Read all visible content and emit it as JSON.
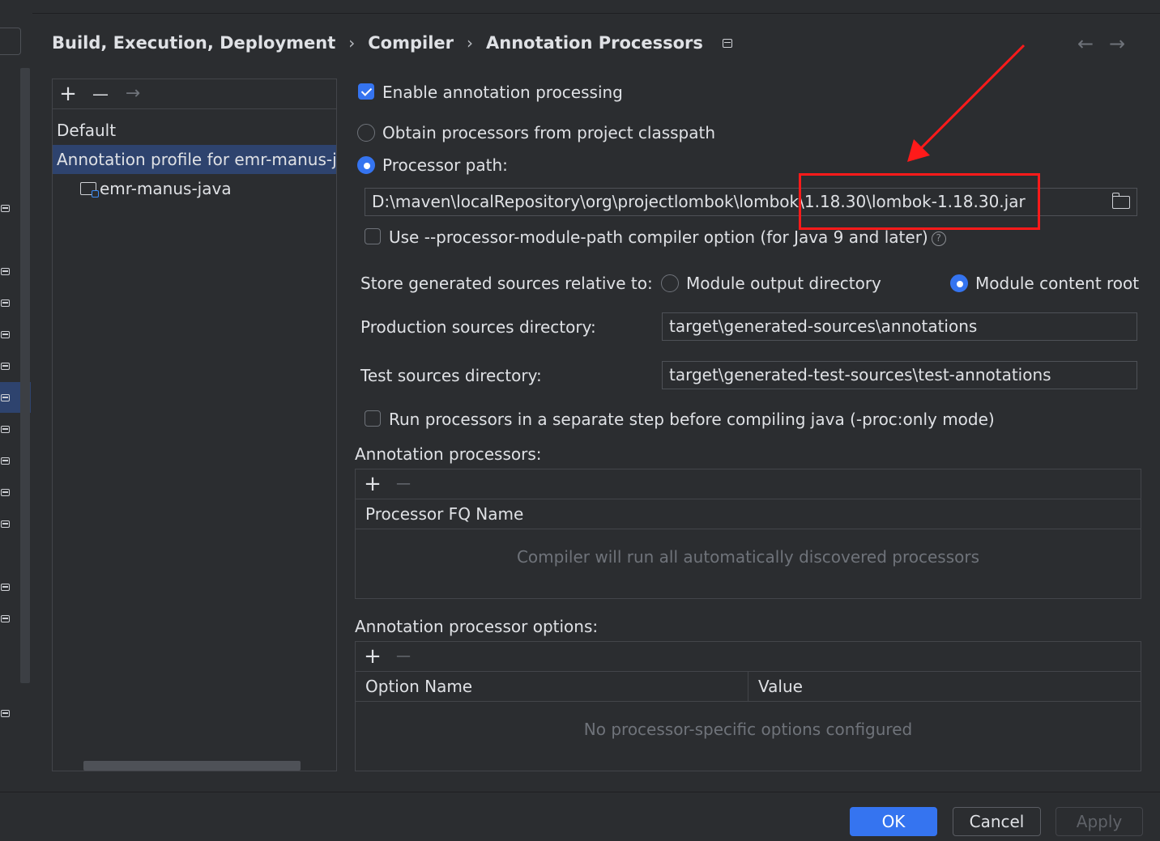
{
  "breadcrumb": {
    "items": [
      "Build, Execution, Deployment",
      "Compiler",
      "Annotation Processors"
    ],
    "separator": "›"
  },
  "nav": {
    "back": "←",
    "forward": "→"
  },
  "profiles": {
    "toolbar": {
      "add": "+",
      "remove": "—",
      "move": "→"
    },
    "items": [
      {
        "label": "Default"
      },
      {
        "label": "Annotation profile for emr-manus-java"
      },
      {
        "label": "emr-manus-java"
      }
    ]
  },
  "settings": {
    "enable_label": "Enable annotation processing",
    "enable_checked": true,
    "obtain_label": "Obtain processors from project classpath",
    "processor_path_label": "Processor path:",
    "processor_path_value": "D:\\maven\\localRepository\\org\\projectlombok\\lombok\\1.18.30\\lombok-1.18.30.jar",
    "module_path_label": "Use --processor-module-path compiler option (for Java 9 and later)",
    "help_glyph": "?",
    "store_label": "Store generated sources relative to:",
    "store_option_output": "Module output directory",
    "store_option_content": "Module content root",
    "production_label": "Production sources directory:",
    "production_value": "target\\generated-sources\\annotations",
    "test_label": "Test sources directory:",
    "test_value": "target\\generated-test-sources\\test-annotations",
    "separate_step_label": "Run processors in a separate step before compiling java (-proc:only mode)"
  },
  "processors": {
    "title": "Annotation processors:",
    "column": "Processor FQ Name",
    "empty_text": "Compiler will run all automatically discovered processors",
    "add": "+",
    "remove": "—"
  },
  "options": {
    "title": "Annotation processor options:",
    "columns": [
      "Option Name",
      "Value"
    ],
    "empty_text": "No processor-specific options configured",
    "add": "+",
    "remove": "—"
  },
  "buttons": {
    "ok": "OK",
    "cancel": "Cancel",
    "apply": "Apply"
  },
  "colors": {
    "accent": "#3574f0",
    "background": "#2b2d30",
    "annotation_red": "#ff1a1a"
  }
}
